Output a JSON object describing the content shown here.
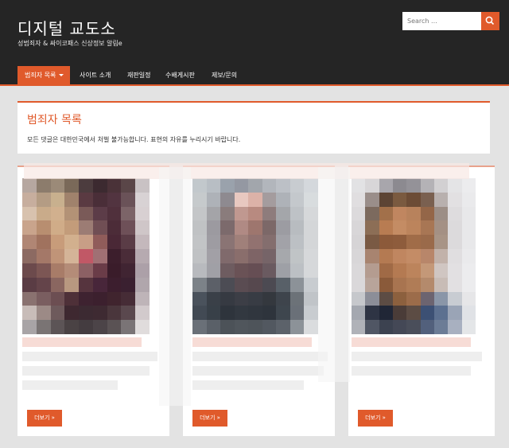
{
  "site": {
    "title": "디지털 교도소",
    "description": "성범죄자 & 싸이코패스 신상정보 알림e"
  },
  "search": {
    "placeholder": "Search ..."
  },
  "nav": {
    "items": [
      {
        "label": "범죄자 목록",
        "active": true
      },
      {
        "label": "사이트 소개"
      },
      {
        "label": "재판일정"
      },
      {
        "label": "수배게시판"
      },
      {
        "label": "제보/문의"
      }
    ]
  },
  "page": {
    "title": "범죄자 목록",
    "note": "모든 댓글은 대한민국에서 처벌 불가능합니다. 표현의 자유를 누리시기 바랍니다."
  },
  "cards": [
    {
      "more_label": "더보기 »"
    },
    {
      "more_label": "더보기 »"
    },
    {
      "more_label": "더보기 »"
    }
  ],
  "colors": {
    "accent": "#e05a2b",
    "header_bg": "#252525",
    "page_bg": "#e3e3e3"
  }
}
